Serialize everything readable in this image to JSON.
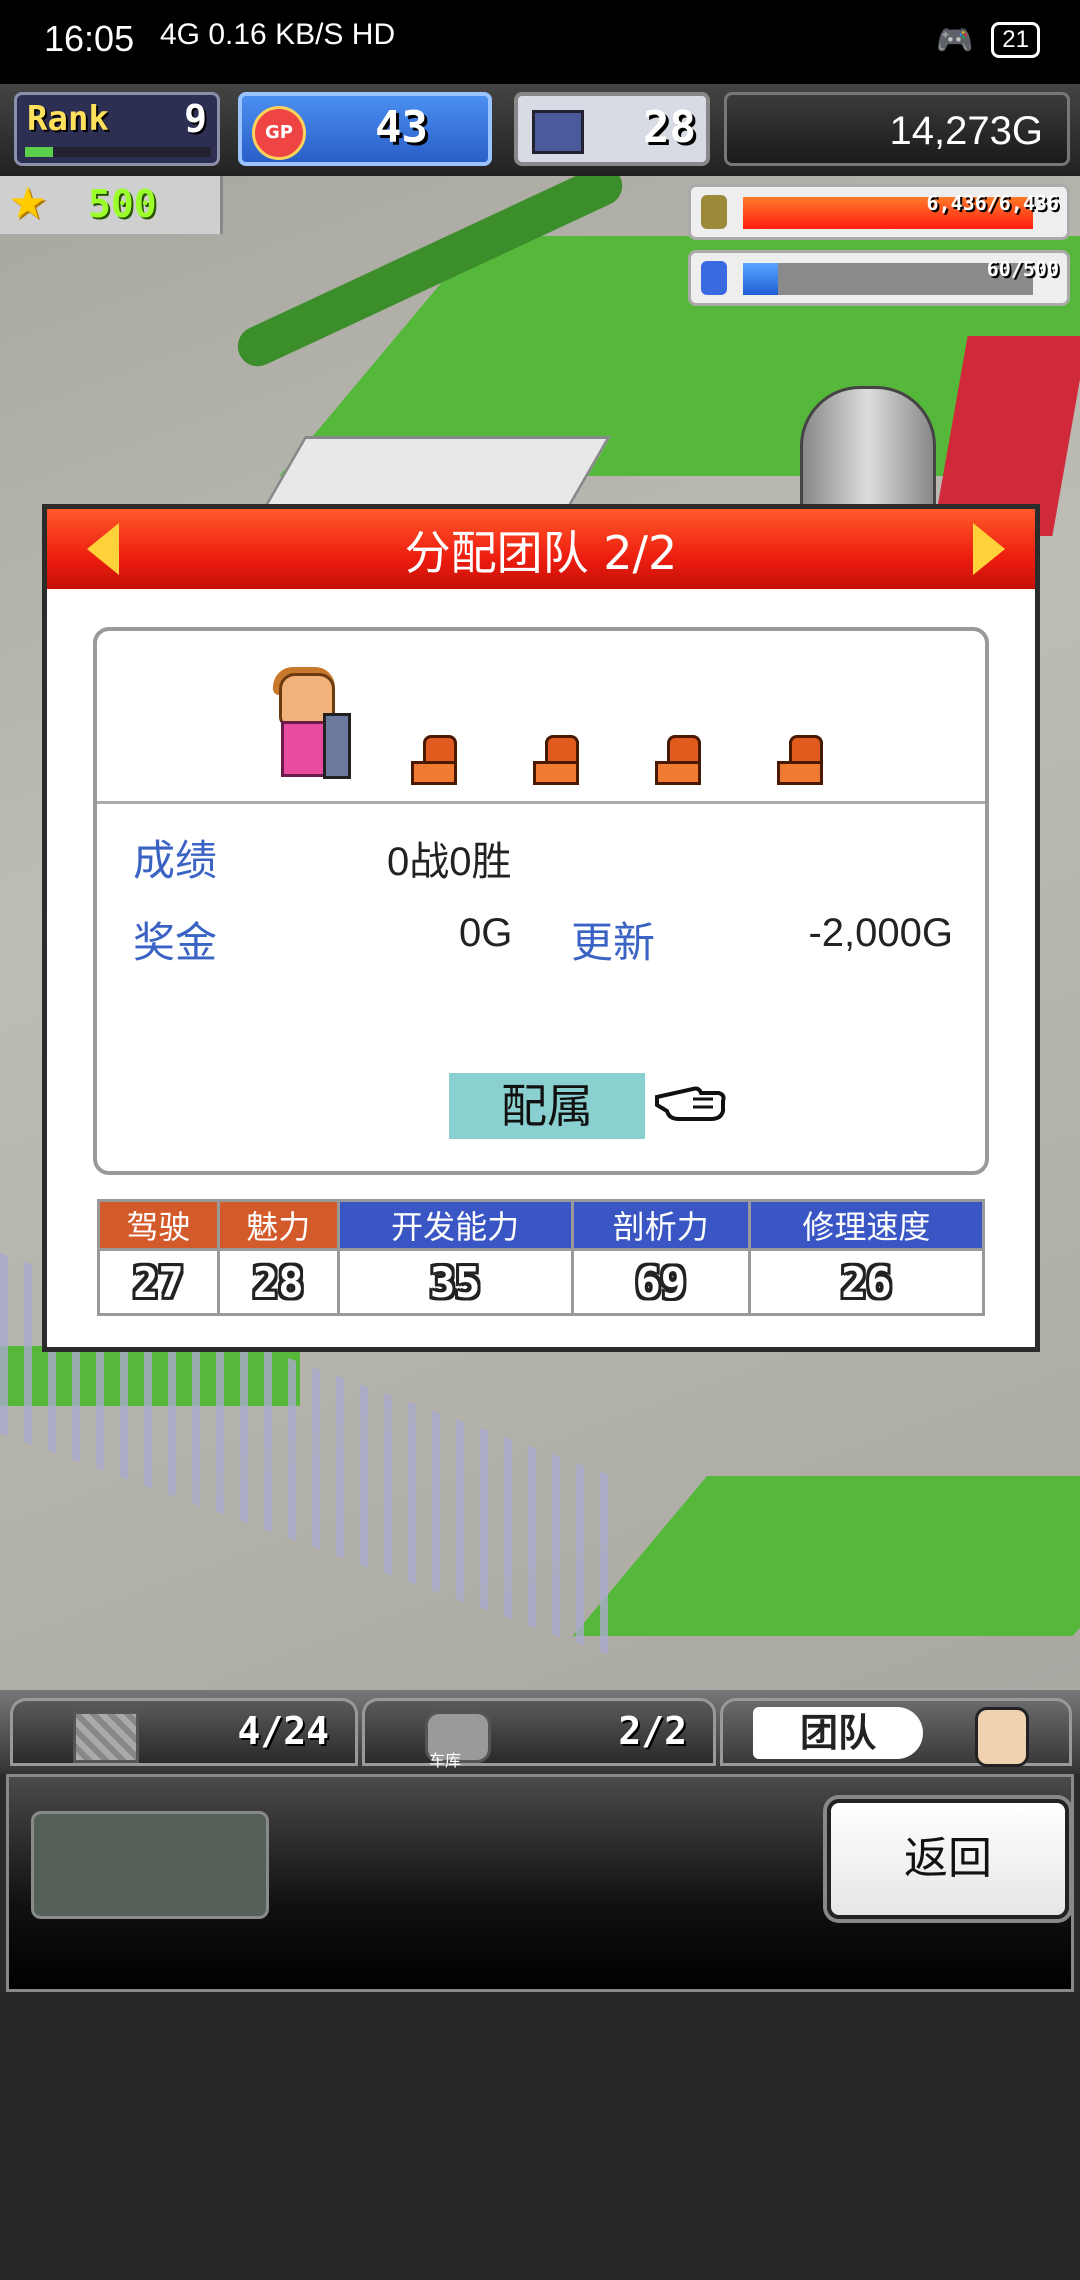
{
  "status_bar": {
    "time": "16:05",
    "network": "4G 0.16 KB/S HD",
    "battery": "21"
  },
  "hud": {
    "rank_label": "Rank",
    "rank_value": "9",
    "gp_icon": "GP",
    "gp_value": "43",
    "pc_value": "28",
    "money": "14,273G"
  },
  "world": {
    "stars": "500",
    "fuel": "6,436/6,436",
    "fuel_fraction": 1.0,
    "parts": "60/500",
    "parts_fraction": 0.12
  },
  "dialog": {
    "title": "分配团队 2/2",
    "record_label": "成绩",
    "record_value": "0战0胜",
    "prize_label": "奖金",
    "prize_value": "0G",
    "renew_label": "更新",
    "renew_value": "-2,000G",
    "assign_button": "配属",
    "stats": [
      {
        "label": "驾驶",
        "value": "27",
        "color": "orange"
      },
      {
        "label": "魅力",
        "value": "28",
        "color": "orange"
      },
      {
        "label": "开发能力",
        "value": "35",
        "color": "blue"
      },
      {
        "label": "剖析力",
        "value": "69",
        "color": "blue"
      },
      {
        "label": "修理速度",
        "value": "26",
        "color": "blue"
      }
    ]
  },
  "tabs": {
    "storage_count": "4/24",
    "garage_count": "2/2",
    "garage_sub": "车库",
    "team_label": "团队"
  },
  "bottom": {
    "back_button": "返回"
  }
}
